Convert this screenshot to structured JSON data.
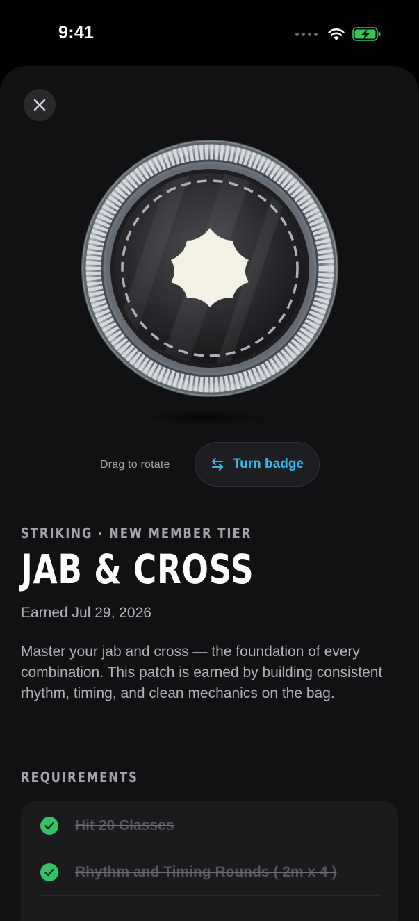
{
  "status_bar": {
    "time": "9:41",
    "icons": [
      "signal-icon",
      "wifi-icon",
      "battery-charging-icon"
    ],
    "battery_color": "#34c759"
  },
  "sheet": {
    "close_icon": "close-icon"
  },
  "badge": {
    "emblem_icon": "star-seal-icon",
    "emblem_color": "#f3f0e6"
  },
  "rotate": {
    "hint": "Drag to rotate",
    "button_label": "Turn badge",
    "button_icon": "swap-arrows-icon",
    "accent": "#37b6ea"
  },
  "achievement": {
    "category": "STRIKING · NEW MEMBER TIER",
    "title": "JAB & CROSS",
    "earned": "Earned Jul 29, 2026",
    "description": "Master your jab and cross — the foundation of every combination. This patch is earned by building consistent rhythm, timing, and clean mechanics on the bag."
  },
  "requirements": {
    "heading": "REQUIREMENTS",
    "check_color": "#34c16a",
    "items": [
      {
        "label": "Hit 20 Classes",
        "completed": true
      },
      {
        "label": "Rhythm and Timing Rounds ( 2m x 4 )",
        "completed": true
      }
    ]
  }
}
